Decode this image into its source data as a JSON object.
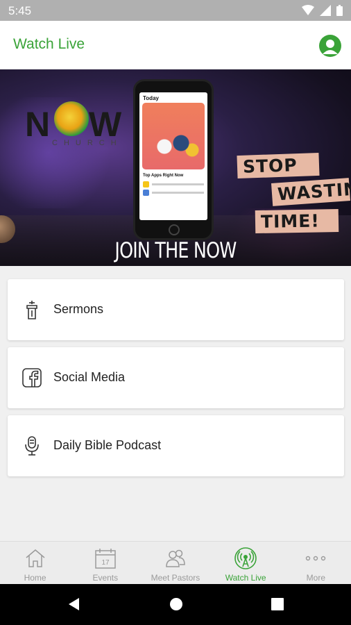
{
  "status_bar": {
    "time": "5:45"
  },
  "app_bar": {
    "title": "Watch Live"
  },
  "banner": {
    "logo_letters_left": "N",
    "logo_letters_right": "W",
    "logo_subtitle": "CHURCH",
    "phone_screen_heading": "Today",
    "phone_section_title": "Top Apps Right Now",
    "sign_lines": [
      "STOP",
      "WASTING",
      "TIME!"
    ],
    "caption": "JOIN THE NOW"
  },
  "menu": {
    "items": [
      {
        "label": "Sermons",
        "icon": "pulpit-icon"
      },
      {
        "label": "Social Media",
        "icon": "facebook-icon"
      },
      {
        "label": "Daily Bible Podcast",
        "icon": "microphone-icon"
      }
    ]
  },
  "bottom_nav": {
    "items": [
      {
        "label": "Home",
        "icon": "home-icon"
      },
      {
        "label": "Events",
        "icon": "calendar-icon",
        "calendar_day": "17"
      },
      {
        "label": "Meet Pastors",
        "icon": "people-icon"
      },
      {
        "label": "Watch Live",
        "icon": "broadcast-icon",
        "active": true
      },
      {
        "label": "More",
        "icon": "more-dots-icon"
      }
    ]
  },
  "colors": {
    "accent": "#3aa338",
    "nav_inactive": "#9a9a9a",
    "status_bar": "#b0b0b0"
  }
}
